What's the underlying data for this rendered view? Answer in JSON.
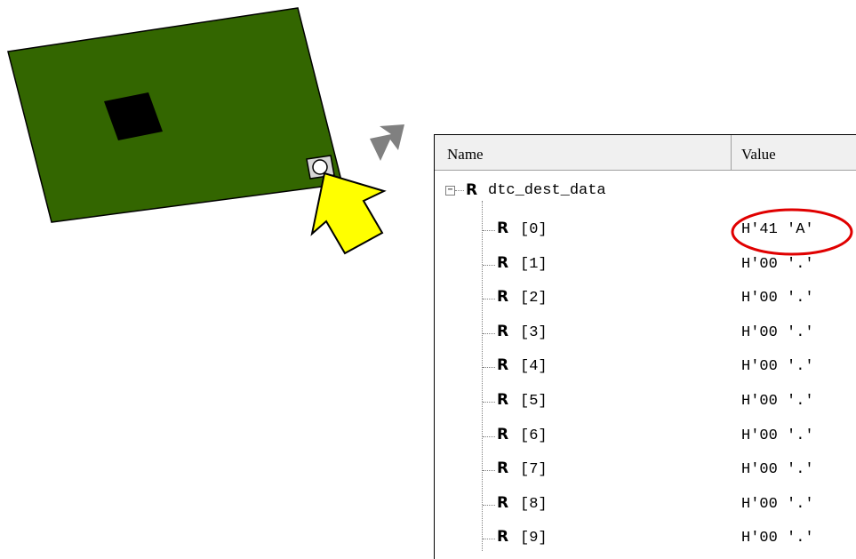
{
  "watch": {
    "columns": {
      "name": "Name",
      "value": "Value"
    },
    "root": {
      "name": "dtc_dest_data",
      "icon": "r-icon"
    },
    "expander_symbol": "−",
    "rows": [
      {
        "name": "[0]",
        "value": "H'41 'A'"
      },
      {
        "name": "[1]",
        "value": "H'00 '.'"
      },
      {
        "name": "[2]",
        "value": "H'00 '.'"
      },
      {
        "name": "[3]",
        "value": "H'00 '.'"
      },
      {
        "name": "[4]",
        "value": "H'00 '.'"
      },
      {
        "name": "[5]",
        "value": "H'00 '.'"
      },
      {
        "name": "[6]",
        "value": "H'00 '.'"
      },
      {
        "name": "[7]",
        "value": "H'00 '.'"
      },
      {
        "name": "[8]",
        "value": "H'00 '.'"
      },
      {
        "name": "[9]",
        "value": "H'00 '.'"
      }
    ],
    "row_icon_text": "R"
  },
  "colors": {
    "board": "#336600",
    "chip": "#000000",
    "arrow_gray": "#808080",
    "pointer_yellow": "#ffff00",
    "highlight_circle": "#e00000"
  }
}
